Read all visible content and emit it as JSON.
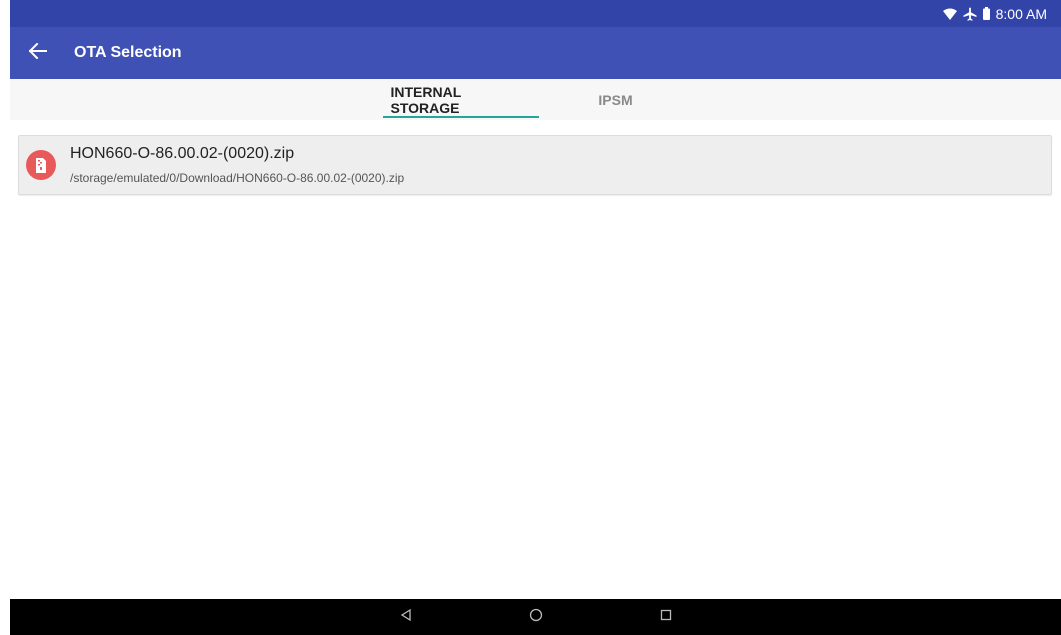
{
  "status_bar": {
    "time": "8:00 AM",
    "icons": [
      "wifi-icon",
      "airplane-mode-icon",
      "battery-icon"
    ]
  },
  "app_bar": {
    "title": "OTA Selection",
    "back_icon": "arrow-back-icon",
    "color": "#3f51b5"
  },
  "tabs": [
    {
      "label": "INTERNAL STORAGE",
      "selected": true
    },
    {
      "label": "IPSM",
      "selected": false
    }
  ],
  "files": [
    {
      "icon": "zip-file-icon",
      "name": "HON660-O-86.00.02-(0020).zip",
      "path": "/storage/emulated/0/Download/HON660-O-86.00.02-(0020).zip"
    }
  ],
  "nav_bar": {
    "icons": [
      "back-triangle-icon",
      "home-circle-icon",
      "recents-square-icon"
    ]
  },
  "colors": {
    "status_bar": "#3244a8",
    "tab_indicator": "#26a69a",
    "file_icon": "#e85a5a"
  }
}
